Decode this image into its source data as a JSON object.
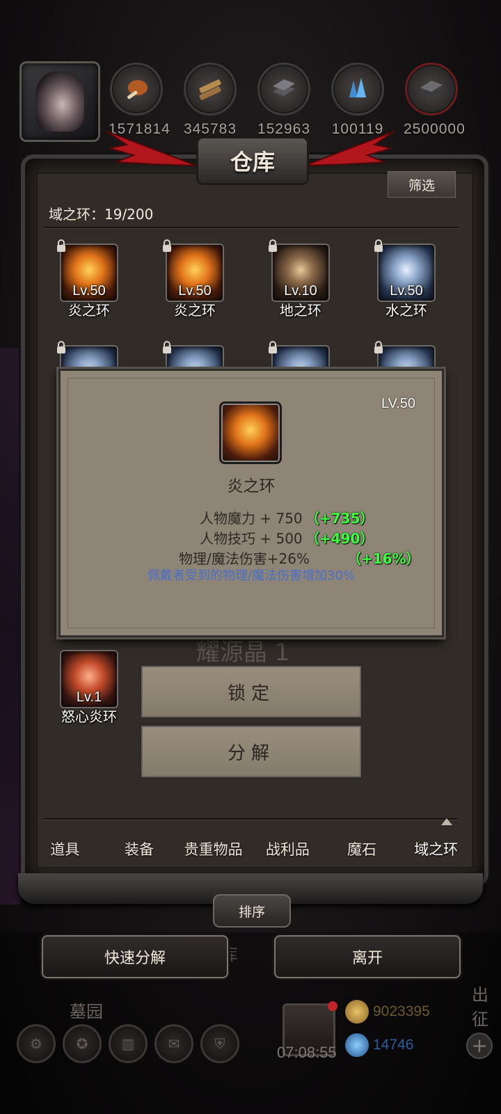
{
  "resources": [
    {
      "icon": "meat-icon",
      "value": "1571814"
    },
    {
      "icon": "wood-icon",
      "value": "345783"
    },
    {
      "icon": "iron-icon",
      "value": "152963"
    },
    {
      "icon": "crystal-icon",
      "value": "100119"
    },
    {
      "icon": "ore-icon",
      "value": "2500000"
    }
  ],
  "window": {
    "title": "仓库",
    "filter_label": "筛选",
    "count_label": "域之环：19/200"
  },
  "items_row1": [
    {
      "level": "Lv.50",
      "name": "炎之环",
      "type": "fire"
    },
    {
      "level": "Lv.50",
      "name": "炎之环",
      "type": "fire"
    },
    {
      "level": "Lv.10",
      "name": "地之环",
      "type": "earth"
    },
    {
      "level": "Lv.50",
      "name": "水之环",
      "type": "water"
    }
  ],
  "item_bottom": {
    "level": "Lv.1",
    "name": "怒心炎环",
    "type": "rage"
  },
  "ghost_label": "耀源晶 1",
  "tooltip": {
    "level": "LV.50",
    "name": "炎之环",
    "stats": [
      {
        "text": "人物魔力 + 750",
        "bonus": "（+735）"
      },
      {
        "text": "人物技巧 + 500",
        "bonus": "（+490）"
      },
      {
        "text": "物理/魔法伤害+26%",
        "bonus": "（+16%）"
      }
    ],
    "description": "佩戴者受到的物理/魔法伤害增加30%"
  },
  "actions": {
    "lock": "锁定",
    "decompose": "分解"
  },
  "tabs": [
    "道具",
    "装备",
    "贵重物品",
    "战利品",
    "魔石",
    "域之环"
  ],
  "active_tab": "域之环",
  "sort_label": "排序",
  "quick_decompose_label": "快速分解",
  "leave_label": "离开",
  "hud": {
    "cemetery_label": "墓园",
    "behind_label": "库",
    "sortie_label": "出征",
    "timer": "07:08:55",
    "gold": "9023395",
    "gems": "14746"
  },
  "colors": {
    "bonus_green": "#3dff3d",
    "desc_blue": "#4a6fc9",
    "gold_text": "#6e5a2a",
    "gem_text": "#2d5c9c"
  }
}
